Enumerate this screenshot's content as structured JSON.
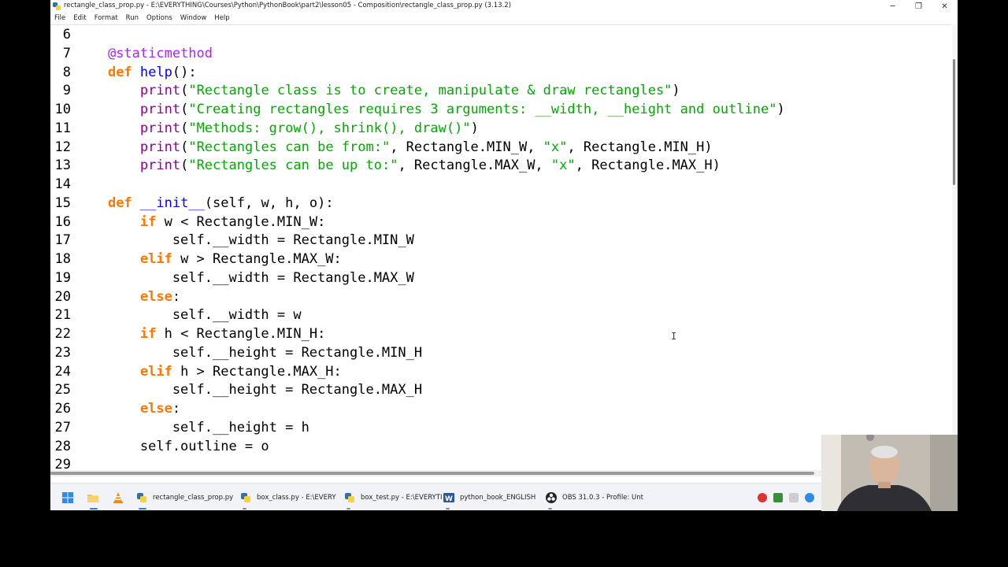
{
  "window": {
    "title": "rectangle_class_prop.py - E:\\EVERYTHING\\Courses\\Python\\PythonBook\\part2\\lesson05 - Composition\\rectangle_class_prop.py (3.13.2)",
    "minimize": "─",
    "restore": "❐",
    "close": "✕"
  },
  "menu": [
    "File",
    "Edit",
    "Format",
    "Run",
    "Options",
    "Window",
    "Help"
  ],
  "code_lines": [
    {
      "n": "6",
      "t": [
        {
          "c": "tx",
          "s": ""
        }
      ]
    },
    {
      "n": "7",
      "t": [
        {
          "c": "tx",
          "s": "    "
        },
        {
          "c": "dc",
          "s": "@staticmethod"
        }
      ]
    },
    {
      "n": "8",
      "t": [
        {
          "c": "tx",
          "s": "    "
        },
        {
          "c": "kw",
          "s": "def"
        },
        {
          "c": "tx",
          "s": " "
        },
        {
          "c": "df",
          "s": "help"
        },
        {
          "c": "tx",
          "s": "():"
        }
      ]
    },
    {
      "n": "9",
      "t": [
        {
          "c": "tx",
          "s": "        "
        },
        {
          "c": "bi",
          "s": "print"
        },
        {
          "c": "tx",
          "s": "("
        },
        {
          "c": "st",
          "s": "\"Rectangle class is to create, manipulate & draw rectangles\""
        },
        {
          "c": "tx",
          "s": ")"
        }
      ]
    },
    {
      "n": "10",
      "t": [
        {
          "c": "tx",
          "s": "        "
        },
        {
          "c": "bi",
          "s": "print"
        },
        {
          "c": "tx",
          "s": "("
        },
        {
          "c": "st",
          "s": "\"Creating rectangles requires 3 arguments: __width, __height and outline\""
        },
        {
          "c": "tx",
          "s": ")"
        }
      ]
    },
    {
      "n": "11",
      "t": [
        {
          "c": "tx",
          "s": "        "
        },
        {
          "c": "bi",
          "s": "print"
        },
        {
          "c": "tx",
          "s": "("
        },
        {
          "c": "st",
          "s": "\"Methods: grow(), shrink(), draw()\""
        },
        {
          "c": "tx",
          "s": ")"
        }
      ]
    },
    {
      "n": "12",
      "t": [
        {
          "c": "tx",
          "s": "        "
        },
        {
          "c": "bi",
          "s": "print"
        },
        {
          "c": "tx",
          "s": "("
        },
        {
          "c": "st",
          "s": "\"Rectangles can be from:\""
        },
        {
          "c": "tx",
          "s": ", Rectangle.MIN_W, "
        },
        {
          "c": "st",
          "s": "\"x\""
        },
        {
          "c": "tx",
          "s": ", Rectangle.MIN_H)"
        }
      ]
    },
    {
      "n": "13",
      "t": [
        {
          "c": "tx",
          "s": "        "
        },
        {
          "c": "bi",
          "s": "print"
        },
        {
          "c": "tx",
          "s": "("
        },
        {
          "c": "st",
          "s": "\"Rectangles can be up to:\""
        },
        {
          "c": "tx",
          "s": ", Rectangle.MAX_W, "
        },
        {
          "c": "st",
          "s": "\"x\""
        },
        {
          "c": "tx",
          "s": ", Rectangle.MAX_H)"
        }
      ]
    },
    {
      "n": "14",
      "t": [
        {
          "c": "tx",
          "s": ""
        }
      ]
    },
    {
      "n": "15",
      "t": [
        {
          "c": "tx",
          "s": "    "
        },
        {
          "c": "kw",
          "s": "def"
        },
        {
          "c": "tx",
          "s": " "
        },
        {
          "c": "df",
          "s": "__init__"
        },
        {
          "c": "tx",
          "s": "(self, w, h, o):"
        }
      ]
    },
    {
      "n": "16",
      "t": [
        {
          "c": "tx",
          "s": "        "
        },
        {
          "c": "kw",
          "s": "if"
        },
        {
          "c": "tx",
          "s": " w < Rectangle.MIN_W:"
        }
      ]
    },
    {
      "n": "17",
      "t": [
        {
          "c": "tx",
          "s": "            self.__width = Rectangle.MIN_W"
        }
      ]
    },
    {
      "n": "18",
      "t": [
        {
          "c": "tx",
          "s": "        "
        },
        {
          "c": "kw",
          "s": "elif"
        },
        {
          "c": "tx",
          "s": " w > Rectangle.MAX_W:"
        }
      ]
    },
    {
      "n": "19",
      "t": [
        {
          "c": "tx",
          "s": "            self.__width = Rectangle.MAX_W"
        }
      ]
    },
    {
      "n": "20",
      "t": [
        {
          "c": "tx",
          "s": "        "
        },
        {
          "c": "kw",
          "s": "else"
        },
        {
          "c": "tx",
          "s": ":"
        }
      ]
    },
    {
      "n": "21",
      "t": [
        {
          "c": "tx",
          "s": "            self.__width = w"
        }
      ]
    },
    {
      "n": "22",
      "t": [
        {
          "c": "tx",
          "s": "        "
        },
        {
          "c": "kw",
          "s": "if"
        },
        {
          "c": "tx",
          "s": " h < Rectangle.MIN_H:"
        }
      ]
    },
    {
      "n": "23",
      "t": [
        {
          "c": "tx",
          "s": "            self.__height = Rectangle.MIN_H"
        }
      ]
    },
    {
      "n": "24",
      "t": [
        {
          "c": "tx",
          "s": "        "
        },
        {
          "c": "kw",
          "s": "elif"
        },
        {
          "c": "tx",
          "s": " h > Rectangle.MAX_H:"
        }
      ]
    },
    {
      "n": "25",
      "t": [
        {
          "c": "tx",
          "s": "            self.__height = Rectangle.MAX_H"
        }
      ]
    },
    {
      "n": "26",
      "t": [
        {
          "c": "tx",
          "s": "        "
        },
        {
          "c": "kw",
          "s": "else"
        },
        {
          "c": "tx",
          "s": ":"
        }
      ]
    },
    {
      "n": "27",
      "t": [
        {
          "c": "tx",
          "s": "            self.__height = h"
        }
      ]
    },
    {
      "n": "28",
      "t": [
        {
          "c": "tx",
          "s": "        self.outline = o"
        }
      ]
    },
    {
      "n": "29",
      "t": [
        {
          "c": "tx",
          "s": ""
        }
      ]
    }
  ],
  "taskbar": {
    "items": [
      {
        "label": "rectangle_class_prop.py",
        "icon": "python-icon",
        "active": true
      },
      {
        "label": "box_class.py - E:\\EVERY",
        "icon": "python-icon",
        "active": false
      },
      {
        "label": "box_test.py - E:\\EVERYTI",
        "icon": "python-icon",
        "active": false
      },
      {
        "label": "python_book_ENGLISH",
        "icon": "word-icon",
        "active": false
      },
      {
        "label": "OBS 31.0.3 - Profile: Unt",
        "icon": "obs-icon",
        "active": false
      }
    ]
  },
  "colors": {
    "keyword": "#ff7700",
    "string": "#00aa00",
    "builtin": "#900090",
    "definition": "#0000ff",
    "decorator": "#aa22ff"
  }
}
